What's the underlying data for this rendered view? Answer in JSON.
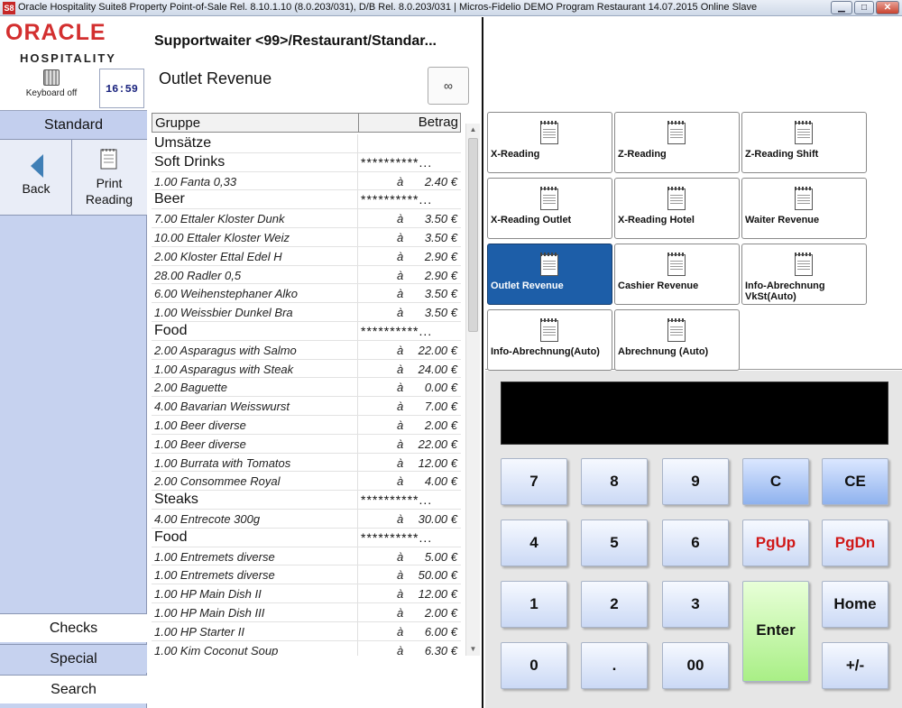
{
  "window": {
    "icon_text": "S8",
    "title": "Oracle Hospitality Suite8 Property Point-of-Sale Rel. 8.10.1.10 (8.0.203/031), D/B Rel. 8.0.203/031 | Micros-Fidelio DEMO Program Restaurant 14.07.2015 Online Slave",
    "min_label": "▁",
    "max_label": "□",
    "close_label": "✕"
  },
  "logo": {
    "line1": "ORACLE",
    "line2": "HOSPITALITY"
  },
  "keyboard_label": "Keyboard off",
  "clock": "16:59",
  "sidebar": {
    "tab": "Standard",
    "back_label": "Back",
    "print_line1": "Print",
    "print_line2": "Reading",
    "checks": "Checks",
    "special": "Special",
    "search": "Search"
  },
  "report": {
    "title": "Supportwaiter <99>/Restaurant/Standar...",
    "subtitle": "Outlet Revenue",
    "glasses_icon": "∞"
  },
  "table": {
    "col1": "Gruppe",
    "col2": "Betrag",
    "group_stars": "**********...",
    "at": "à",
    "rows": [
      {
        "name": "Umsätze",
        "group": true,
        "stars": false
      },
      {
        "name": "Soft Drinks",
        "group": true,
        "stars": true
      },
      {
        "name": "1.00 Fanta 0,33",
        "price": "2.40 €"
      },
      {
        "name": "Beer",
        "group": true,
        "stars": true
      },
      {
        "name": "7.00 Ettaler Kloster Dunk",
        "price": "3.50 €"
      },
      {
        "name": "10.00 Ettaler Kloster Weiz",
        "price": "3.50 €"
      },
      {
        "name": "2.00 Kloster Ettal Edel H",
        "price": "2.90 €"
      },
      {
        "name": "28.00 Radler 0,5",
        "price": "2.90 €"
      },
      {
        "name": "6.00 Weihenstephaner Alko",
        "price": "3.50 €"
      },
      {
        "name": "1.00 Weissbier Dunkel Bra",
        "price": "3.50 €"
      },
      {
        "name": "Food",
        "group": true,
        "stars": true
      },
      {
        "name": "2.00 Asparagus with Salmo",
        "price": "22.00 €"
      },
      {
        "name": "1.00 Asparagus with Steak",
        "price": "24.00 €"
      },
      {
        "name": "2.00 Baguette",
        "price": "0.00 €"
      },
      {
        "name": "4.00 Bavarian Weisswurst",
        "price": "7.00 €"
      },
      {
        "name": "1.00 Beer diverse",
        "price": "2.00 €"
      },
      {
        "name": "1.00 Beer diverse",
        "price": "22.00 €"
      },
      {
        "name": "1.00 Burrata with Tomatos",
        "price": "12.00 €"
      },
      {
        "name": "2.00 Consommee Royal",
        "price": "4.00 €"
      },
      {
        "name": "Steaks",
        "group": true,
        "stars": true
      },
      {
        "name": "4.00 Entrecote 300g",
        "price": "30.00 €"
      },
      {
        "name": "Food",
        "group": true,
        "stars": true
      },
      {
        "name": "1.00 Entremets diverse",
        "price": "5.00 €"
      },
      {
        "name": "1.00 Entremets diverse",
        "price": "50.00 €"
      },
      {
        "name": "1.00 HP Main Dish II",
        "price": "12.00 €"
      },
      {
        "name": "1.00 HP Main Dish III",
        "price": "2.00 €"
      },
      {
        "name": "1.00 HP Starter II",
        "price": "6.00 €"
      },
      {
        "name": "1.00 Kim Coconut Soup",
        "price": "6.30 €"
      }
    ]
  },
  "functions": [
    {
      "label": "X-Reading",
      "name": "x-reading-button"
    },
    {
      "label": "Z-Reading",
      "name": "z-reading-button"
    },
    {
      "label": "Z-Reading Shift",
      "name": "z-reading-shift-button"
    },
    {
      "label": "X-Reading Outlet",
      "name": "x-reading-outlet-button"
    },
    {
      "label": "X-Reading Hotel",
      "name": "x-reading-hotel-button"
    },
    {
      "label": "Waiter Revenue",
      "name": "waiter-revenue-button"
    },
    {
      "label": "Outlet Revenue",
      "name": "outlet-revenue-button",
      "active": true
    },
    {
      "label": "Cashier Revenue",
      "name": "cashier-revenue-button"
    },
    {
      "label": "Info-Abrechnung VkSt(Auto)",
      "name": "info-abrechnung-vkst-button"
    },
    {
      "label": "Info-Abrechnung(Auto)",
      "name": "info-abrechnung-auto-button"
    },
    {
      "label": "Abrechnung (Auto)",
      "name": "abrechnung-auto-button"
    }
  ],
  "display_value": "",
  "numpad": {
    "k7": "7",
    "k8": "8",
    "k9": "9",
    "kc": "C",
    "kce": "CE",
    "k4": "4",
    "k5": "5",
    "k6": "6",
    "pgup": "PgUp",
    "pgdn": "PgDn",
    "k1": "1",
    "k2": "2",
    "k3": "3",
    "enter": "Enter",
    "home": "Home",
    "k0": "0",
    "dot": ".",
    "k00": "00",
    "plusminus": "+/-"
  },
  "colors": {
    "accent_blue": "#1d5ea8",
    "sidebar": "#c6d2ef",
    "brand_red": "#d32f2f",
    "key_red": "#d01818",
    "enter_green": "#a9ef86"
  }
}
